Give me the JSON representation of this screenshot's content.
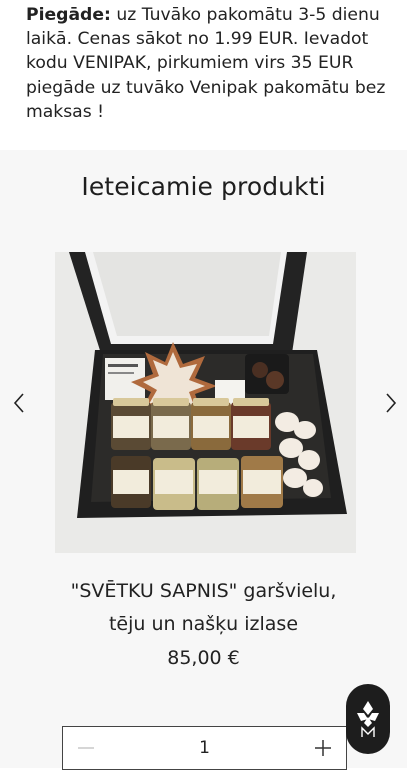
{
  "delivery": {
    "label": "Piegāde:",
    "text": " uz Tuvāko pakomātu 3-5 dienu laikā. Cenas sākot no 1.99 EUR. Ievadot kodu VENIPAK, pirkumiem virs 35 EUR piegāde uz tuvāko Venipak pakomātu bez maksas !"
  },
  "recommended": {
    "title": "Ieteicamie produkti",
    "prev_icon": "chevron-left-icon",
    "next_icon": "chevron-right-icon"
  },
  "product": {
    "name_line1": "\"SVĒTKU SAPNIS\" garšvielu,",
    "name_line2": "tēju un našķu izlase",
    "price": "85,00 €",
    "image": "gift-box-photo"
  },
  "quantity": {
    "value": "1",
    "minus_icon": "minus-icon",
    "plus_icon": "plus-icon"
  },
  "badge": {
    "icon": "brand-logo-icon"
  },
  "colors": {
    "section_bg": "#f7f7f7",
    "text": "#1a1a1a",
    "badge_bg": "#1d1d1d"
  }
}
